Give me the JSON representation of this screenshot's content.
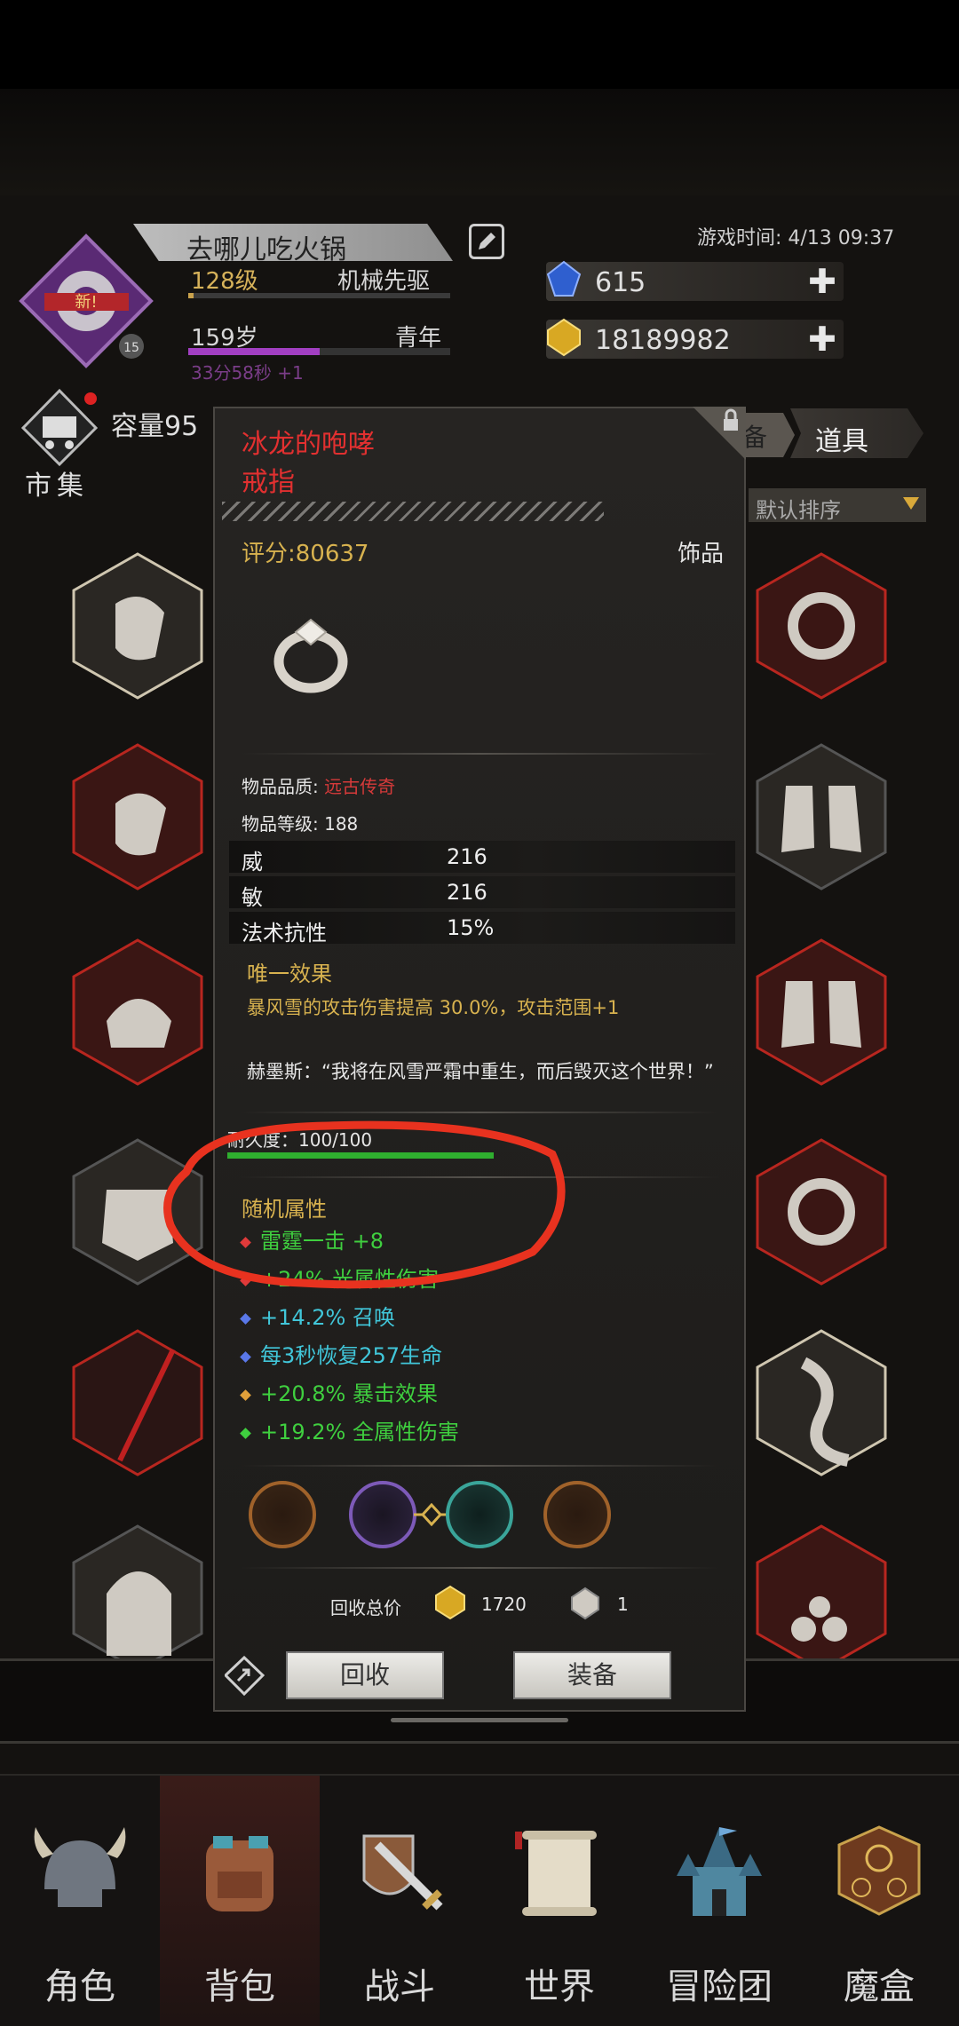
{
  "header": {
    "player_name": "去哪儿吃火锅",
    "level": "128级",
    "class": "机械先驱",
    "level_progress": 0.02,
    "age": "159岁",
    "age_stage": "青年",
    "age_progress": 0.5,
    "age_timer": "33分58秒 +1",
    "avatar_badge": "新!",
    "avatar_level": "15",
    "game_time": "游戏时间: 4/13 09:37",
    "gems": "615",
    "gold": "18189982"
  },
  "toolbar": {
    "market_label": "市集",
    "capacity_label": "容量95",
    "tab_equip": "备",
    "tab_items": "道具",
    "sort_label": "默认排序"
  },
  "item": {
    "name": "冰龙的咆哮",
    "type": "戒指",
    "score": "评分:80637",
    "category": "饰品",
    "quality_label": "物品品质: ",
    "quality_value": "远古传奇",
    "item_level": "物品等级: 188",
    "attributes": [
      {
        "key": "威",
        "value": "216"
      },
      {
        "key": "敏",
        "value": "216"
      },
      {
        "key": "法术抗性",
        "value": "15%"
      }
    ],
    "unique_title": "唯一效果",
    "unique_desc": "暴风雪的攻击伤害提高 30.0%，攻击范围+1",
    "quote": "赫墨斯：“我将在风雪严霜中重生，而后毁灭这个世界！”",
    "durability_label": "耐久度：100/100",
    "durability": 1.0,
    "random_title": "随机属性",
    "random_stats": [
      {
        "text": "雷霆一击 +8",
        "color": "#3fcf3f",
        "dot": "#e03a3a"
      },
      {
        "text": "+24% 光属性伤害",
        "color": "#3fcf3f",
        "dot": "#e03a3a"
      },
      {
        "text": "+14.2% 召唤",
        "color": "#41c6d9",
        "dot": "#5a78e8"
      },
      {
        "text": "每3秒恢复257生命",
        "color": "#41c6d9",
        "dot": "#5a78e8"
      },
      {
        "text": "+20.8% 暴击效果",
        "color": "#3fcf3f",
        "dot": "#e0a03a"
      },
      {
        "text": "+19.2% 全属性伤害",
        "color": "#3fcf3f",
        "dot": "#3fcf3f"
      }
    ],
    "recycle_label": "回收总价",
    "recycle_gold": "1720",
    "recycle_shard": "1",
    "btn_recycle": "回收",
    "btn_equip": "装备"
  },
  "nav": [
    {
      "label": "角色",
      "icon": "helmet-icon"
    },
    {
      "label": "背包",
      "icon": "backpack-icon"
    },
    {
      "label": "战斗",
      "icon": "sword-shield-icon"
    },
    {
      "label": "世界",
      "icon": "scroll-map-icon"
    },
    {
      "label": "冒险团",
      "icon": "castle-icon"
    },
    {
      "label": "魔盒",
      "icon": "magic-box-icon"
    }
  ],
  "colors": {
    "accent_gold": "#d8b24f",
    "legendary_red": "#e23030",
    "annotation_red": "#e8321f"
  }
}
